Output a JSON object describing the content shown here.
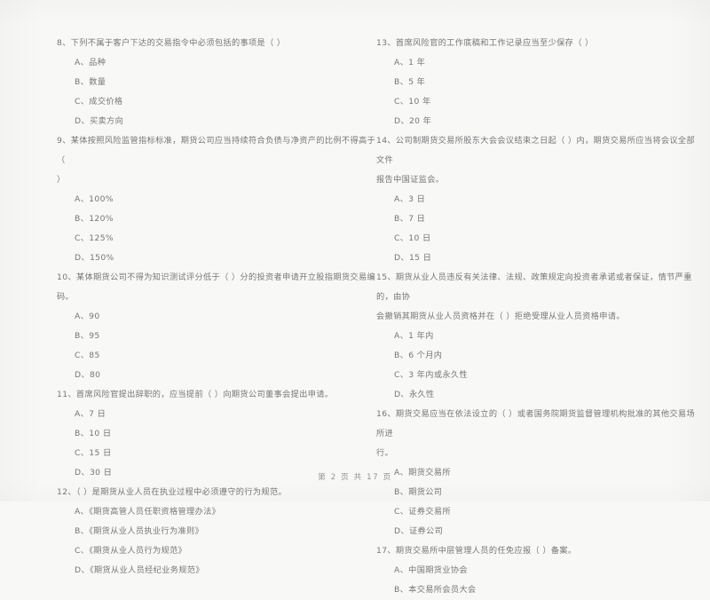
{
  "document": {
    "type": "scanned-exam-paper",
    "footer": "第 2 页  共 17 页",
    "colors": {
      "page_background": "#f8f8f7",
      "text": "#6d6d6d",
      "footer_text": "#8a8a8a"
    }
  },
  "columns": {
    "left": {
      "questions": [
        {
          "number": "8",
          "stem": "8、下列不属于客户下达的交易指令中必须包括的事项是（      ）",
          "stem_continued": "",
          "options": [
            "A、品种",
            "B、数量",
            "C、成交价格",
            "D、买卖方向"
          ]
        },
        {
          "number": "9",
          "stem": "9、某体按照风险监管指标标准，期货公司应当持续符合负债与净资产的比例不得高于（",
          "stem_continued": "）",
          "options": [
            "A、100%",
            "B、120%",
            "C、125%",
            "D、150%"
          ]
        },
        {
          "number": "10",
          "stem": "10、某体期货公司不得为知识测试评分低于（      ）分的投资者申请开立股指期货交易编码。",
          "stem_continued": "",
          "options": [
            "A、90",
            "B、95",
            "C、85",
            "D、80"
          ]
        },
        {
          "number": "11",
          "stem": "11、首席风险官提出辞职的，应当提前（     ）向期货公司董事会提出申请。",
          "stem_continued": "",
          "options": [
            "A、7 日",
            "B、10 日",
            "C、15 日",
            "D、30 日"
          ]
        },
        {
          "number": "12",
          "stem": "12、（      ）是期货从业人员在执业过程中必须遵守的行为规范。",
          "stem_continued": "",
          "options": [
            "A、《期货高管人员任职资格管理办法》",
            "B、《期货从业人员执业行为准则》",
            "C、《期货从业人员行为规范》",
            "D、《期货从业人员经纪业务规范》"
          ]
        }
      ]
    },
    "right": {
      "questions": [
        {
          "number": "13",
          "stem": "13、首席风险官的工作底稿和工作记录应当至少保存（      ）",
          "stem_continued": "",
          "options": [
            "A、1 年",
            "B、5 年",
            "C、10 年",
            "D、20 年"
          ]
        },
        {
          "number": "14",
          "stem": "14、公司制期货交易所股东大会会议结束之日起（      ）内，期货交易所应当将会议全部文件",
          "stem_continued": "报告中国证监会。",
          "options": [
            "A、3 日",
            "B、7 日",
            "C、10 日",
            "D、15 日"
          ]
        },
        {
          "number": "15",
          "stem": "15、期货从业人员违反有关法律、法规、政策规定向投资者承诺或者保证，情节严重的，由协",
          "stem_continued": "会撤销其期货从业人员资格并在（      ）拒绝受理从业人员资格申请。",
          "options": [
            "A、1 年内",
            "B、6 个月内",
            "C、3 年内或永久性",
            "D、永久性"
          ]
        },
        {
          "number": "16",
          "stem": "16、期货交易应当在依法设立的（      ）或者国务院期货监督管理机构批准的其他交易场所进",
          "stem_continued": "行。",
          "options": [
            "A、期货交易所",
            "B、期货公司",
            "C、证券交易所",
            "D、证券公司"
          ]
        },
        {
          "number": "17",
          "stem": "17、期货交易所中层管理人员的任免应报（      ）备案。",
          "stem_continued": "",
          "options": [
            "A、中国期货业协会",
            "B、本交易所会员大会"
          ]
        }
      ]
    }
  }
}
